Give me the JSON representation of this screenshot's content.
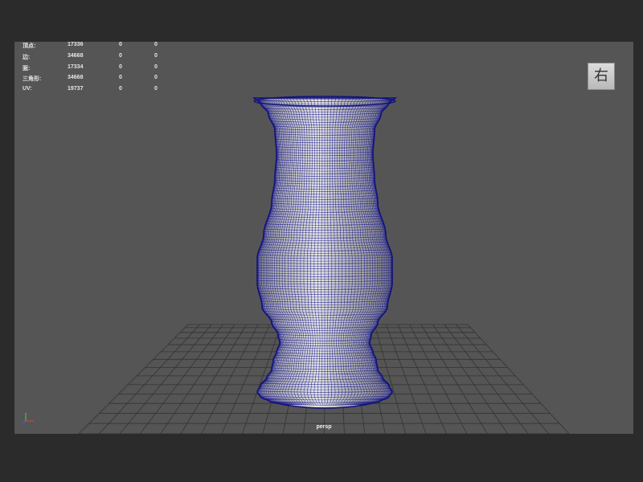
{
  "viewport": {
    "camera": "persp",
    "viewcube_label": "右",
    "heads_up": {
      "rows": [
        {
          "label": "顶点:",
          "values": [
            "17336",
            "0",
            "0"
          ]
        },
        {
          "label": "边:",
          "values": [
            "34668",
            "0",
            "0"
          ]
        },
        {
          "label": "面:",
          "values": [
            "17334",
            "0",
            "0"
          ]
        },
        {
          "label": "三角形:",
          "values": [
            "34668",
            "0",
            "0"
          ]
        },
        {
          "label": "UV:",
          "values": [
            "19737",
            "0",
            "0"
          ]
        }
      ]
    },
    "axis_icon": "axis-triad-icon"
  },
  "colors": {
    "window_bg": "#2b2b2b",
    "viewport_bg": "#555555",
    "grid": "#333333",
    "wireframe": "#1a1a8c"
  }
}
